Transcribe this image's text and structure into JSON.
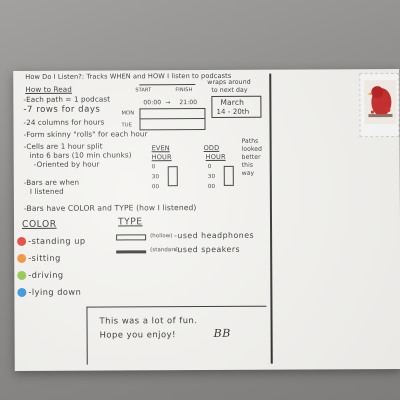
{
  "scene": {
    "description_colors": {
      "backdrop": "#8f8d8c",
      "card": "#f3f2ef",
      "ink": "#1c1c1c"
    }
  },
  "card": {
    "heading": "How Do I Listen?: Tracks WHEN and HOW I listen to podcasts",
    "how_to_read": "How to Read",
    "lines": [
      "-Each path = 1 podcast",
      "-7 rows for days",
      "-24 columns for hours",
      "-Form skinny \"rolls\" for each hour",
      "-Cells are 1 hour split",
      "into 6 bars (10 min chunks)",
      "-Oriented by hour",
      "-Bars are when",
      "I listened",
      "-Bars have COLOR and TYPE (how I listened)"
    ],
    "timeline": {
      "start": "START",
      "finish": "FINISH",
      "wraps": "wraps around",
      "wraps2": "to next day",
      "time_from": "00:00",
      "arrow": "→",
      "time_to": "21:00",
      "mon": "MON",
      "tue": "TUE",
      "date_line1": "March",
      "date_line2": "14 - 20th"
    },
    "even": {
      "title1": "EVEN",
      "title2": "HOUR",
      "t1": "0",
      "t2": "30",
      "t3": "00"
    },
    "odd": {
      "title1": "ODD",
      "title2": "HOUR",
      "t1": "0",
      "t2": "30",
      "t3": "00"
    },
    "paths_note": [
      "Paths",
      "looked",
      "better",
      "this",
      "way"
    ],
    "color_title": "COLOR",
    "type_title": "TYPE",
    "colors": [
      {
        "label": "-standing up",
        "hex": "#e0352b"
      },
      {
        "label": "-sitting",
        "hex": "#f08a2a"
      },
      {
        "label": "-driving",
        "hex": "#8cc63e"
      },
      {
        "label": "-lying down",
        "hex": "#2a8fd6"
      }
    ],
    "types": [
      {
        "note": "(hollow)",
        "label": "-used headphones"
      },
      {
        "note": "(standard)",
        "label": "-used speakers"
      }
    ],
    "closing_line1": "This was a lot of fun.",
    "closing_line2": "Hope you enjoy!",
    "signature": "BB"
  }
}
